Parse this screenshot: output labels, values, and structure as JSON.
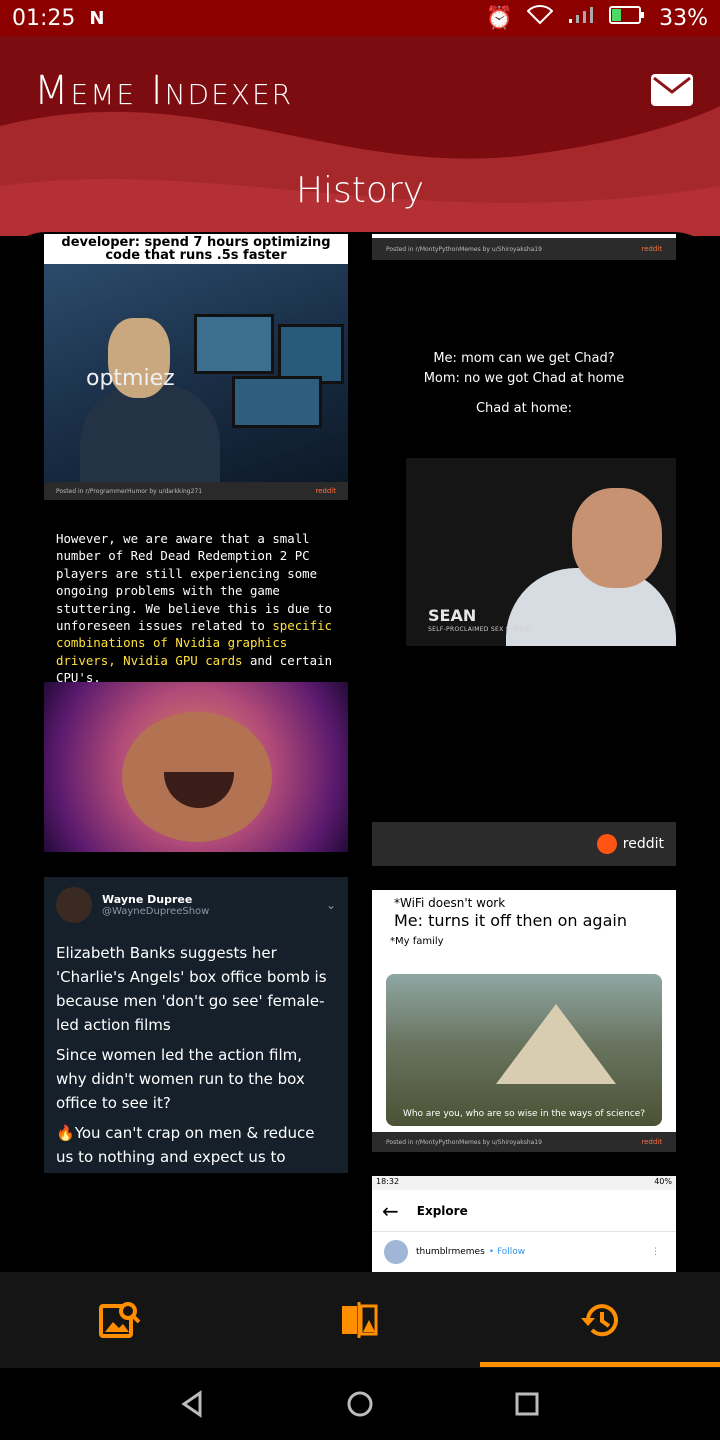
{
  "status_bar": {
    "time": "01:25",
    "battery": "33%"
  },
  "header": {
    "app_title": "Meme Indexer",
    "page_title": "History"
  },
  "feed": {
    "dev_meme": {
      "caption": "developer: spend 7 hours optimizing code that runs .5s faster",
      "label": "optmiez",
      "footer": "Posted in r/ProgrammerHumor by u/darkking271",
      "badge": "reddit"
    },
    "strip_top": {
      "footer": "Posted in r/MontyPythonMemes by u/Shiroyaksha19",
      "badge": "reddit"
    },
    "chad": {
      "line1": "Me: mom can we get Chad?",
      "line2": "Mom: no we got Chad at home",
      "line3": "Chad at home:",
      "name": "SEAN",
      "subtitle": "SELF-PROCLAIMED SEX SYMBOL"
    },
    "reddit_bar": {
      "label": "reddit"
    },
    "rdr": {
      "text_plain": "However, we are aware that a small number of Red Dead Redemption 2 PC players are still experiencing some ongoing problems with the game stuttering. We believe this is due to unforeseen issues related to",
      "text_highlight": "specific combinations of Nvidia graphics drivers, Nvidia GPU cards",
      "text_end": "and certain CPU's."
    },
    "tweet": {
      "name": "Wayne Dupree",
      "handle": "@WayneDupreeShow",
      "p1": "Elizabeth Banks suggests her 'Charlie's Angels' box office bomb is because men 'don't go see' female-led action films",
      "p2": "Since women led the action film, why didn't women run to the box office to see it?",
      "p3": "You can't crap on men & reduce us to nothing and expect us to support ya"
    },
    "wifi": {
      "line1": "*WiFi doesn't work",
      "line2": "Me: turns it off then on again",
      "line3": "*My family",
      "subtitle": "Who are you, who are so wise in the ways of science?",
      "footer": "Posted in r/MontyPythonMemes by u/Shiroyaksha19",
      "badge": "reddit"
    },
    "explore": {
      "time": "18:32",
      "battery": "40%",
      "title": "Explore",
      "account": "thumblrmemes",
      "follow": "Follow"
    }
  },
  "bottom_nav": {
    "active": "history",
    "accent": "#ff8f00"
  },
  "colors": {
    "header_dark": "#7d0c10",
    "header_light": "#a6282b",
    "statusbar": "#8d0000"
  }
}
